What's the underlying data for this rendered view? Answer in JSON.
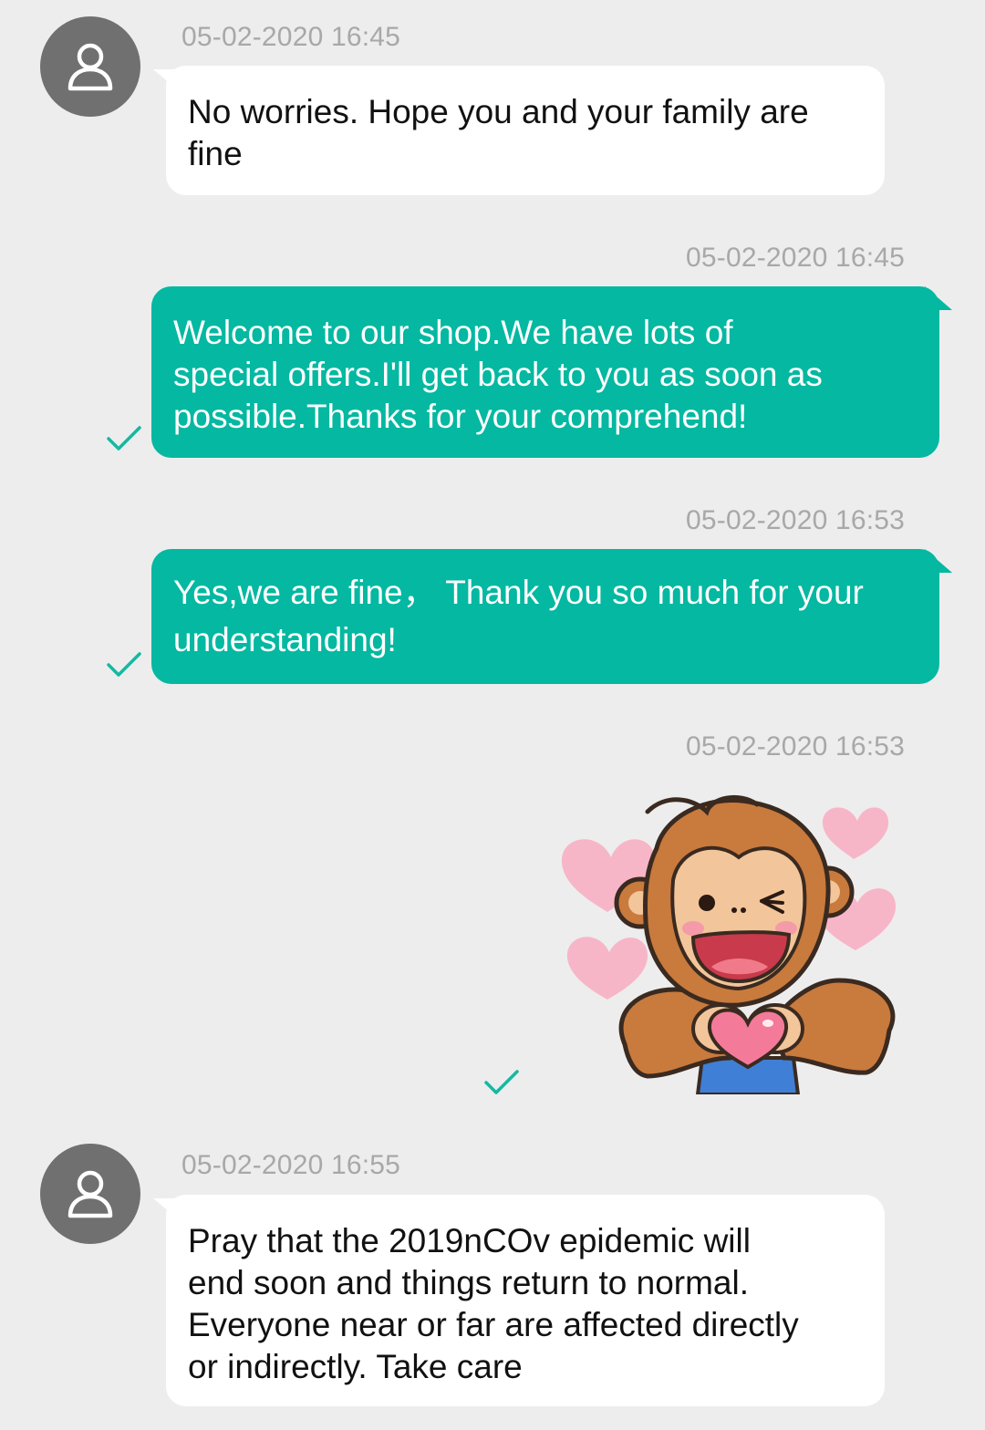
{
  "theme": {
    "background": "#ededed",
    "outgoing_bubble": "#04b8a1",
    "incoming_bubble": "#ffffff",
    "timestamp_color": "#a8a8a8",
    "avatar_color": "#707070",
    "check_color": "#16b8a0"
  },
  "messages": [
    {
      "direction": "incoming",
      "timestamp": "05-02-2020 16:45",
      "text_lines": [
        "No worries. Hope you and your family are",
        "fine"
      ],
      "avatar_icon": "user-icon"
    },
    {
      "direction": "outgoing",
      "timestamp": "05-02-2020 16:45",
      "text_lines": [
        "Welcome to our shop.We have lots of",
        "special offers.I'll get back to you as soon as",
        "possible.Thanks for your comprehend!"
      ],
      "status_icon": "check-icon"
    },
    {
      "direction": "outgoing",
      "timestamp": "05-02-2020 16:53",
      "text_lines": [
        "Yes,we are fine， Thank you so much for your",
        "understanding!"
      ],
      "status_icon": "check-icon"
    },
    {
      "direction": "outgoing",
      "timestamp": "05-02-2020 16:53",
      "sticker": "monkey-heart-sticker",
      "status_icon": "check-icon"
    },
    {
      "direction": "incoming",
      "timestamp": "05-02-2020 16:55",
      "text_lines": [
        "Pray that the 2019nCOv epidemic will",
        "end soon and things return to normal.",
        "Everyone near or far are affected directly",
        "or indirectly. Take care"
      ],
      "avatar_icon": "user-icon"
    }
  ]
}
